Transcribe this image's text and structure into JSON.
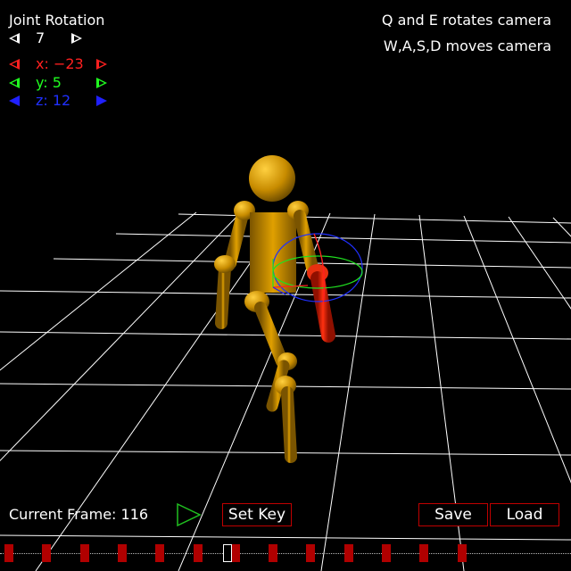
{
  "joint_panel": {
    "title": "Joint Rotation",
    "joint_index": "7",
    "x_label": "x: −23",
    "y_label": "y: 5",
    "z_label": "z: 12"
  },
  "help": {
    "line1": "Q and E rotates camera",
    "line2": "W,A,S,D moves camera"
  },
  "bottom_bar": {
    "current_frame": "Current Frame: 116",
    "set_key_label": "Set Key",
    "save_label": "Save",
    "load_label": "Load"
  },
  "colors": {
    "x_axis": "#ff2020",
    "y_axis": "#20ff20",
    "z_axis": "#2020ff",
    "figure": "#d89a00",
    "selected_limb": "#e01000",
    "button_border": "#c00000"
  },
  "timeline": {
    "keyframe_count": 13,
    "current_position": 0.39
  }
}
